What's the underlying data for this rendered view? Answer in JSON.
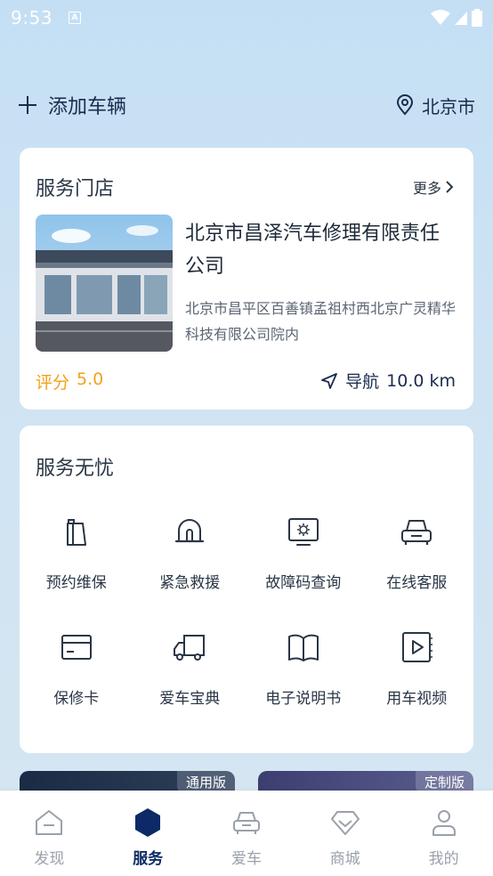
{
  "status_bar": {
    "time": "9:53",
    "notification_icon": "a-icon"
  },
  "header": {
    "add_vehicle_label": "添加车辆",
    "city": "北京市"
  },
  "store_card": {
    "title": "服务门店",
    "more_label": "更多",
    "store": {
      "name": "北京市昌泽汽车修理有限责任公司",
      "address": "北京市昌平区百善镇孟祖村西北京广灵精华科技有限公司院内",
      "rating_label": "评分",
      "rating_value": "5.0",
      "nav_label": "导航",
      "distance": "10.0 km"
    }
  },
  "service_card": {
    "title": "服务无忧",
    "items": [
      {
        "label": "预约维保",
        "icon": "oil-can-icon"
      },
      {
        "label": "紧急救援",
        "icon": "alarm-light-icon"
      },
      {
        "label": "故障码查询",
        "icon": "diagnostic-screen-icon"
      },
      {
        "label": "在线客服",
        "icon": "car-front-icon"
      },
      {
        "label": "保修卡",
        "icon": "card-icon"
      },
      {
        "label": "爱车宝典",
        "icon": "truck-icon"
      },
      {
        "label": "电子说明书",
        "icon": "book-icon"
      },
      {
        "label": "用车视频",
        "icon": "video-icon"
      }
    ]
  },
  "promos": [
    {
      "tag": "通用版"
    },
    {
      "tag": "定制版"
    }
  ],
  "tabbar": {
    "active": "服务",
    "tabs": [
      {
        "label": "发现"
      },
      {
        "label": "服务"
      },
      {
        "label": "爱车"
      },
      {
        "label": "商城"
      },
      {
        "label": "我的"
      }
    ]
  },
  "colors": {
    "accent": "#0d2a66",
    "rating": "#f0a21a",
    "text": "#1a2c4e"
  }
}
